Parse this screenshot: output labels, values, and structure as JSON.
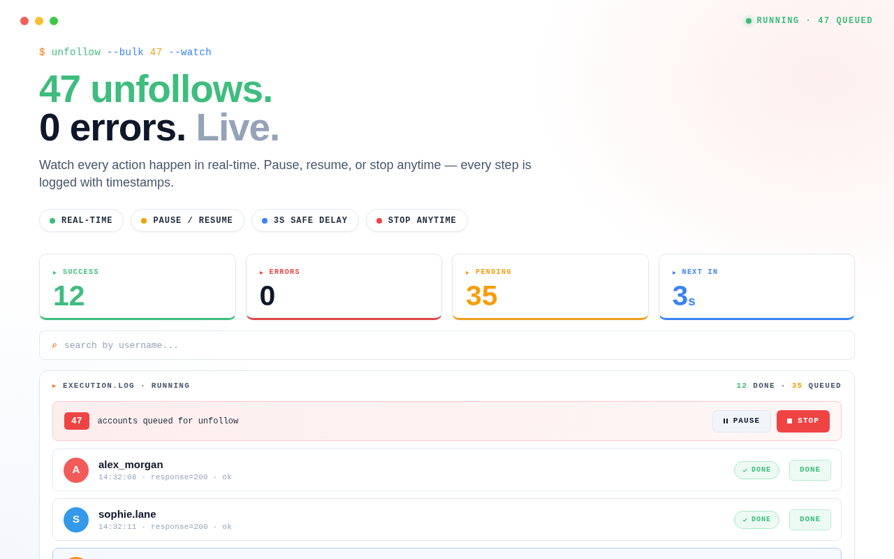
{
  "status": {
    "label": "RUNNING · 47 QUEUED"
  },
  "command": [
    {
      "text": "$",
      "kind": "prompt"
    },
    {
      "text": "unfollow",
      "kind": "cmd"
    },
    {
      "text": "--bulk",
      "kind": "flag"
    },
    {
      "text": "47",
      "kind": "number"
    },
    {
      "text": "--watch",
      "kind": "flag"
    }
  ],
  "headline": [
    [
      {
        "text": "47 unfollows.",
        "kind": "accent"
      }
    ],
    [
      {
        "text": "0 errors.",
        "kind": "strong"
      },
      {
        "text": "Live.",
        "kind": "muted"
      }
    ]
  ],
  "intro": "Watch every action happen in real-time. Pause, resume, or stop anytime — every step is logged with timestamps.",
  "features": [
    {
      "label": "REAL-TIME",
      "color": "#3ebd7e"
    },
    {
      "label": "PAUSE / RESUME",
      "color": "#f59e0b"
    },
    {
      "label": "3S SAFE DELAY",
      "color": "#3b82f6"
    },
    {
      "label": "STOP ANYTIME",
      "color": "#ef4444"
    }
  ],
  "stats": [
    {
      "label": "SUCCESS",
      "value": "12",
      "kind": "success"
    },
    {
      "label": "ERRORS",
      "value": "0",
      "kind": "error"
    },
    {
      "label": "PENDING",
      "value": "35",
      "kind": "pending"
    },
    {
      "label": "NEXT IN",
      "value": "3",
      "unit": "s",
      "kind": "timer"
    }
  ],
  "search": {
    "placeholder": "search by username..."
  },
  "log": {
    "title": "EXECUTION.LOG · RUNNING",
    "summary": [
      {
        "text": "12",
        "kind": "success"
      },
      {
        "text": "DONE ·",
        "kind": "muted"
      },
      {
        "text": "35",
        "kind": "pending"
      },
      {
        "text": "QUEUED",
        "kind": "muted"
      }
    ],
    "banner": {
      "count": "47",
      "text": "accounts queued for unfollow",
      "controls": [
        {
          "label": "PAUSE",
          "kind": "pause"
        },
        {
          "label": "STOP",
          "kind": "stop"
        }
      ]
    },
    "entries": [
      {
        "kind": "done",
        "color": "#f15c5a",
        "initial": "A",
        "username": "alex_morgan",
        "meta": "14:32:08 · response=200 · ok",
        "status": "DONE",
        "action": "DONE"
      },
      {
        "kind": "done",
        "color": "#3399e8",
        "initial": "S",
        "username": "sophie.lane",
        "meta": "14:32:11 · response=200 · ok",
        "status": "DONE",
        "action": "DONE"
      },
      {
        "kind": "active",
        "color": "#f7941d"
      }
    ]
  }
}
